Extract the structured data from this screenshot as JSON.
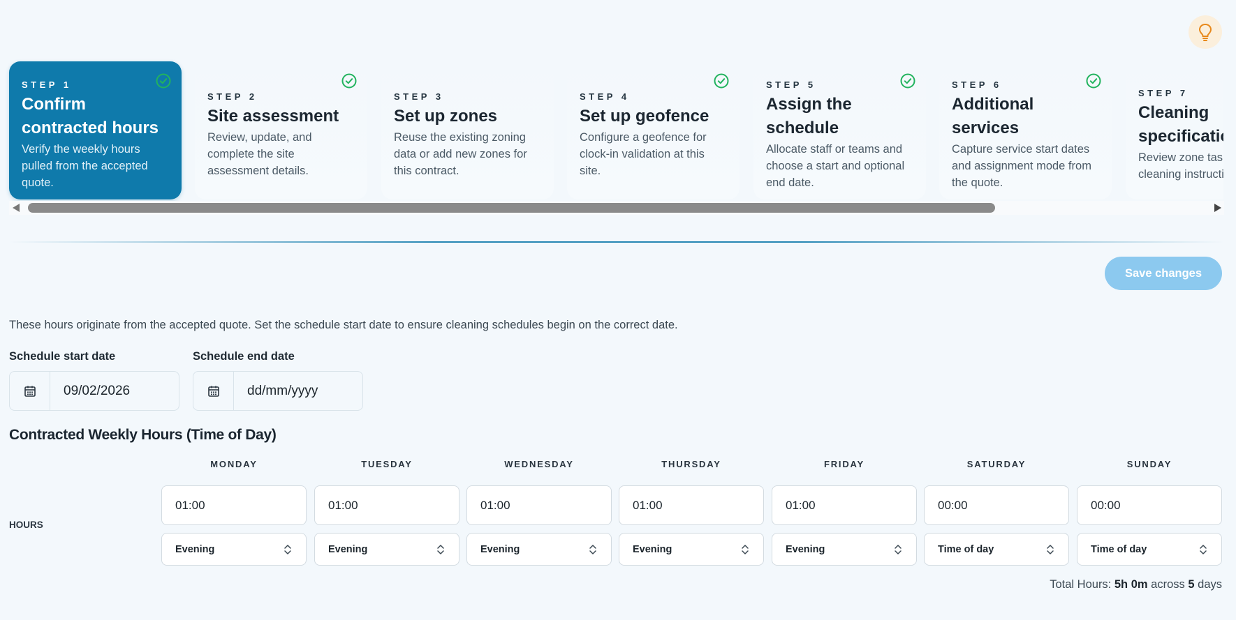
{
  "steps": [
    {
      "number": "STEP 1",
      "title": "Confirm contracted hours",
      "description": "Verify the weekly hours pulled from the accepted quote.",
      "done": true,
      "active": true
    },
    {
      "number": "STEP 2",
      "title": "Site assessment",
      "description": "Review, update, and complete the site assessment details.",
      "done": true,
      "active": false
    },
    {
      "number": "STEP 3",
      "title": "Set up zones",
      "description": "Reuse the existing zoning data or add new zones for this contract.",
      "done": false,
      "active": false
    },
    {
      "number": "STEP 4",
      "title": "Set up geofence",
      "description": "Configure a geofence for clock-in validation at this site.",
      "done": true,
      "active": false
    },
    {
      "number": "STEP 5",
      "title": "Assign the schedule",
      "description": "Allocate staff or teams and choose a start and optional end date.",
      "done": true,
      "active": false
    },
    {
      "number": "STEP 6",
      "title": "Additional services",
      "description": "Capture service start dates and assignment mode from the quote.",
      "done": true,
      "active": false
    },
    {
      "number": "STEP 7",
      "title": "Cleaning specifications",
      "description": "Review zone tasks and cleaning instructions.",
      "done": false,
      "active": false
    }
  ],
  "toolbar": {
    "save_label": "Save changes"
  },
  "intro": "These hours originate from the accepted quote. Set the schedule start date to ensure cleaning schedules begin on the correct date.",
  "schedule": {
    "start_label": "Schedule start date",
    "start_value": "09/02/2026",
    "end_label": "Schedule end date",
    "end_placeholder": "dd/mm/yyyy"
  },
  "weekly": {
    "title": "Contracted Weekly Hours (Time of Day)",
    "row_label": "HOURS",
    "days": [
      {
        "name": "MONDAY",
        "hours": "01:00",
        "time_of_day": "Evening"
      },
      {
        "name": "TUESDAY",
        "hours": "01:00",
        "time_of_day": "Evening"
      },
      {
        "name": "WEDNESDAY",
        "hours": "01:00",
        "time_of_day": "Evening"
      },
      {
        "name": "THURSDAY",
        "hours": "01:00",
        "time_of_day": "Evening"
      },
      {
        "name": "FRIDAY",
        "hours": "01:00",
        "time_of_day": "Evening"
      },
      {
        "name": "SATURDAY",
        "hours": "00:00",
        "time_of_day": "Time of day"
      },
      {
        "name": "SUNDAY",
        "hours": "00:00",
        "time_of_day": "Time of day"
      }
    ]
  },
  "total": {
    "prefix": "Total Hours:",
    "hours": "5h 0m",
    "middle": "across",
    "days": "5",
    "suffix": "days"
  },
  "colors": {
    "accent": "#0f7aab",
    "success": "#22b35e",
    "save_disabled": "#8cc9ef",
    "hint": "#e8891c"
  },
  "icons": {
    "hint": "lightbulb-icon",
    "check": "check-circle-icon",
    "calendar": "calendar-icon",
    "select": "chevron-up-down-icon"
  }
}
